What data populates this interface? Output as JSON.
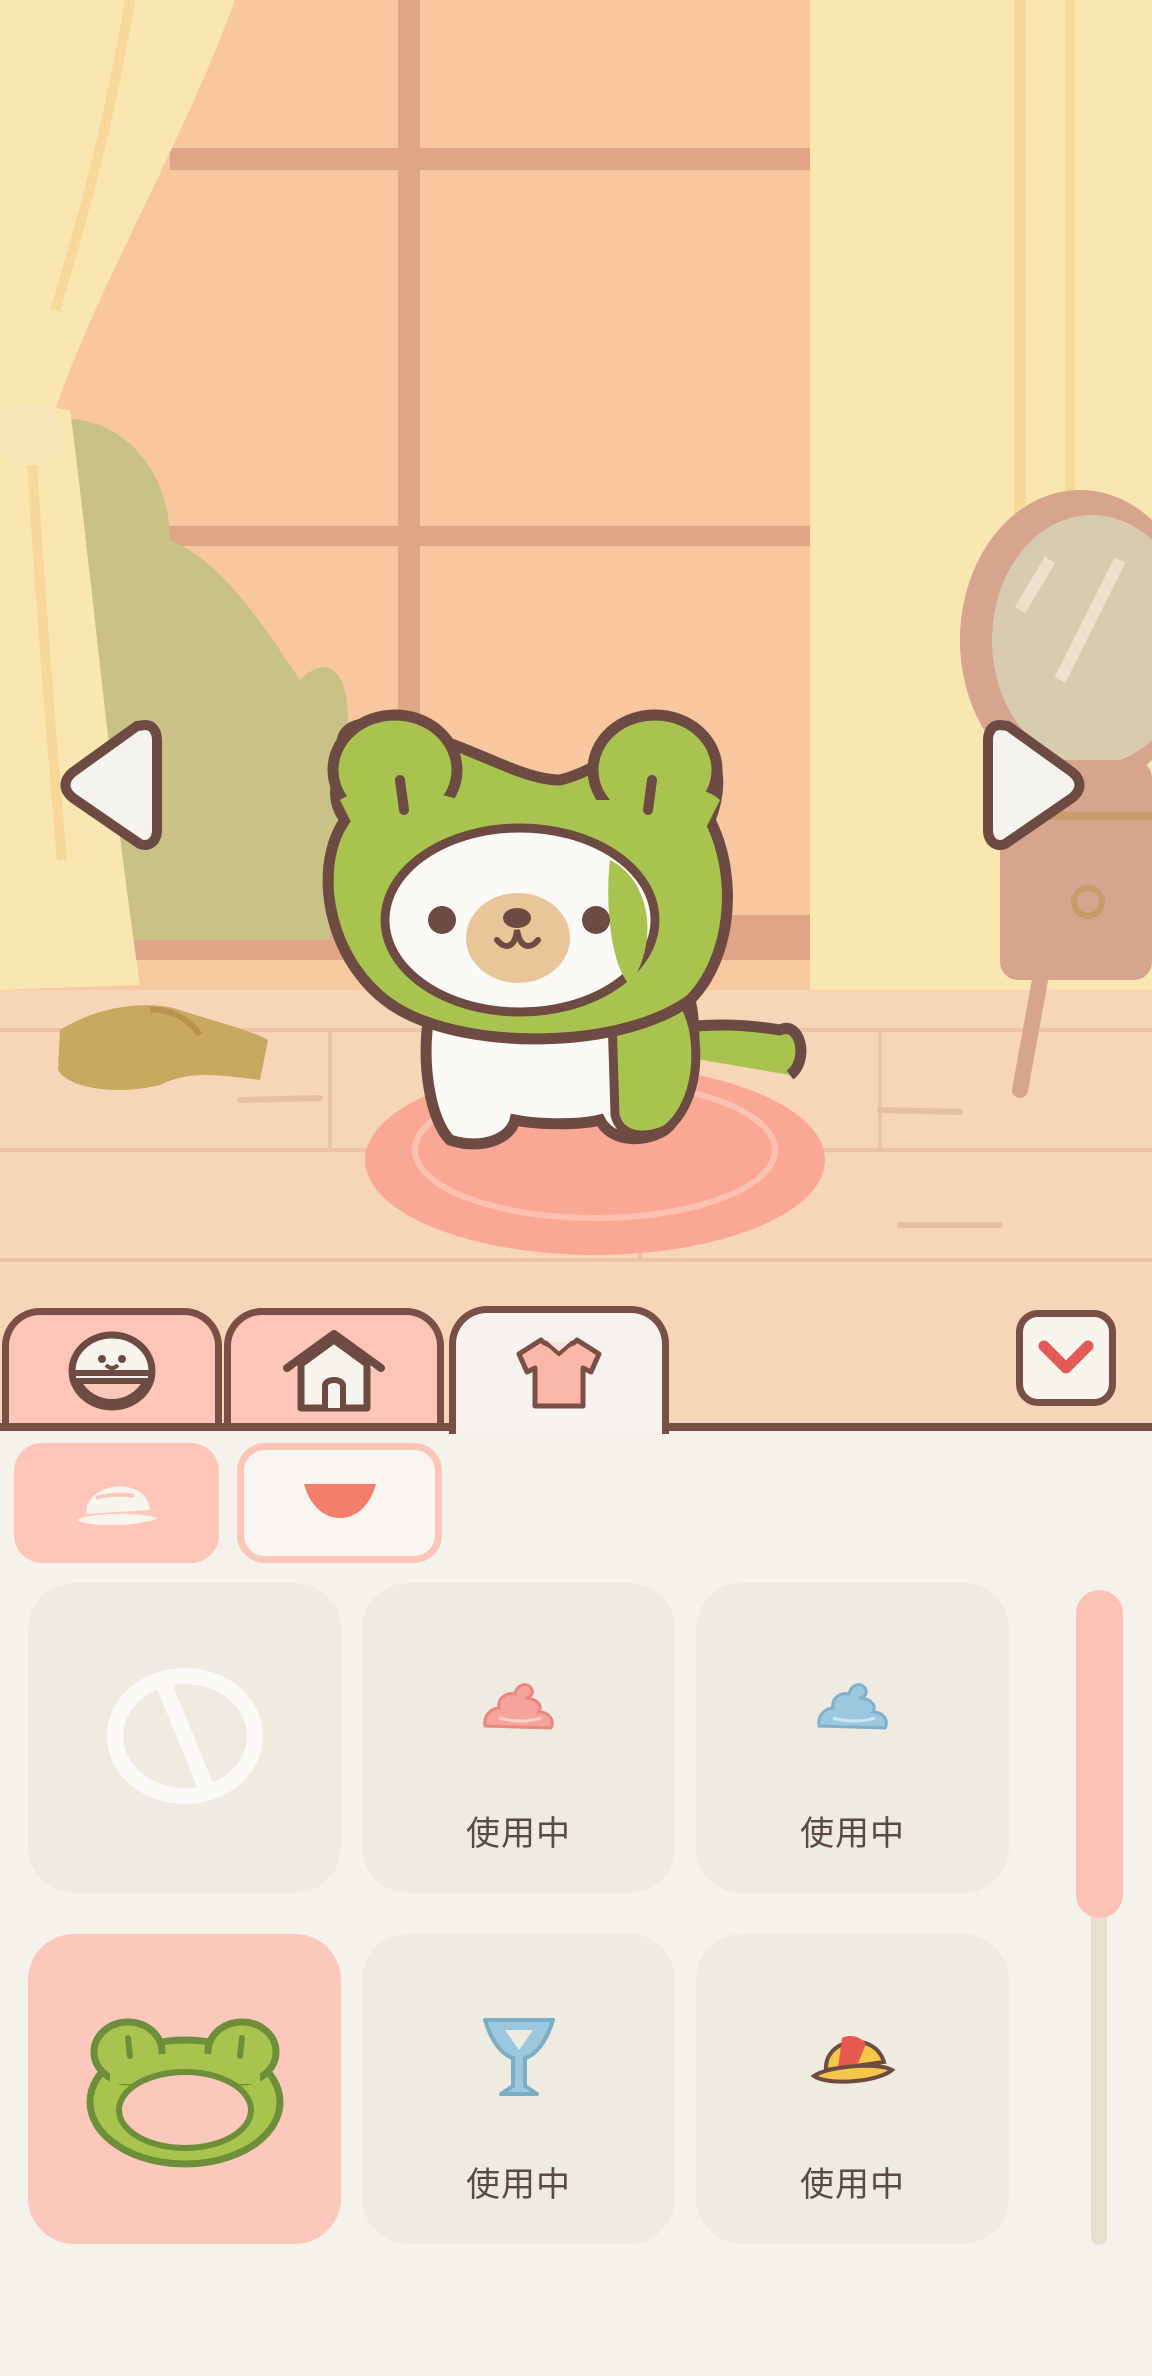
{
  "scene": {
    "nav_left_icon": "arrow-left-icon",
    "nav_right_icon": "arrow-right-icon",
    "pet": "cat-in-frog-hood"
  },
  "tabs": [
    {
      "name": "food",
      "icon": "bowl-icon",
      "active": false
    },
    {
      "name": "house",
      "icon": "house-icon",
      "active": false
    },
    {
      "name": "clothes",
      "icon": "shirt-icon",
      "active": true
    }
  ],
  "collapse_icon": "chevron-down-icon",
  "subcategories": [
    {
      "name": "hat",
      "icon": "cap-icon",
      "active": true
    },
    {
      "name": "neck",
      "icon": "bib-icon",
      "active": false
    }
  ],
  "items": [
    {
      "icon": "none-icon",
      "status": "",
      "selected": false
    },
    {
      "icon": "pink-swirl-icon",
      "status": "使用中",
      "selected": false
    },
    {
      "icon": "blue-swirl-icon",
      "status": "使用中",
      "selected": false
    },
    {
      "icon": "frog-hood-icon",
      "status": "",
      "selected": true
    },
    {
      "icon": "blue-glass-icon",
      "status": "使用中",
      "selected": false
    },
    {
      "icon": "yellow-cap-icon",
      "status": "使用中",
      "selected": false
    }
  ],
  "colors": {
    "outline": "#7a4f45",
    "accent_pink": "#fdc6b8",
    "panel": "#f5f2ec",
    "item_bg": "#efebe1",
    "frog_green": "#a9c44e"
  }
}
